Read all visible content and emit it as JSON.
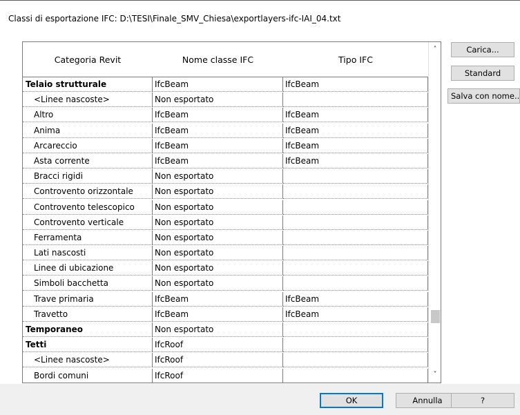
{
  "dialog": {
    "title": "Classi di esportazione IFC: D:\\TESI\\Finale_SMV_Chiesa\\exportlayers-ifc-IAI_04.txt"
  },
  "grid": {
    "columns": [
      "Categoria Revit",
      "Nome classe IFC",
      "Tipo IFC"
    ],
    "rows": [
      {
        "category": "Telaio strutturale",
        "ifc_class": "IfcBeam",
        "ifc_type": "IfcBeam",
        "level": "group"
      },
      {
        "category": "<Linee nascoste>",
        "ifc_class": "Non esportato",
        "ifc_type": "",
        "level": "child"
      },
      {
        "category": "Altro",
        "ifc_class": "IfcBeam",
        "ifc_type": "IfcBeam",
        "level": "child"
      },
      {
        "category": "Anima",
        "ifc_class": "IfcBeam",
        "ifc_type": "IfcBeam",
        "level": "child"
      },
      {
        "category": "Arcareccio",
        "ifc_class": "IfcBeam",
        "ifc_type": "IfcBeam",
        "level": "child"
      },
      {
        "category": "Asta corrente",
        "ifc_class": "IfcBeam",
        "ifc_type": "IfcBeam",
        "level": "child"
      },
      {
        "category": "Bracci rigidi",
        "ifc_class": "Non esportato",
        "ifc_type": "",
        "level": "child"
      },
      {
        "category": "Controvento orizzontale",
        "ifc_class": "Non esportato",
        "ifc_type": "",
        "level": "child"
      },
      {
        "category": "Controvento telescopico",
        "ifc_class": "Non esportato",
        "ifc_type": "",
        "level": "child"
      },
      {
        "category": "Controvento verticale",
        "ifc_class": "Non esportato",
        "ifc_type": "",
        "level": "child"
      },
      {
        "category": "Ferramenta",
        "ifc_class": "Non esportato",
        "ifc_type": "",
        "level": "child"
      },
      {
        "category": "Lati nascosti",
        "ifc_class": "Non esportato",
        "ifc_type": "",
        "level": "child"
      },
      {
        "category": "Linee di ubicazione",
        "ifc_class": "Non esportato",
        "ifc_type": "",
        "level": "child"
      },
      {
        "category": "Simboli bacchetta",
        "ifc_class": "Non esportato",
        "ifc_type": "",
        "level": "child"
      },
      {
        "category": "Trave primaria",
        "ifc_class": "IfcBeam",
        "ifc_type": "IfcBeam",
        "level": "child"
      },
      {
        "category": "Travetto",
        "ifc_class": "IfcBeam",
        "ifc_type": "IfcBeam",
        "level": "child"
      },
      {
        "category": "Temporaneo",
        "ifc_class": "Non esportato",
        "ifc_type": "",
        "level": "group"
      },
      {
        "category": "Tetti",
        "ifc_class": "IfcRoof",
        "ifc_type": "",
        "level": "group"
      },
      {
        "category": "<Linee nascoste>",
        "ifc_class": "IfcRoof",
        "ifc_type": "",
        "level": "child"
      },
      {
        "category": "Bordi comuni",
        "ifc_class": "IfcRoof",
        "ifc_type": "",
        "level": "child"
      }
    ]
  },
  "buttons": {
    "load": "Carica...",
    "standard": "Standard",
    "save_as": "Salva con nome...",
    "ok": "OK",
    "cancel": "Annulla",
    "help": "?"
  },
  "icons": {
    "scroll_up": "chevron-up-icon",
    "scroll_down": "chevron-down-icon"
  },
  "scrollbar": {
    "thumb_position": 0.85
  }
}
